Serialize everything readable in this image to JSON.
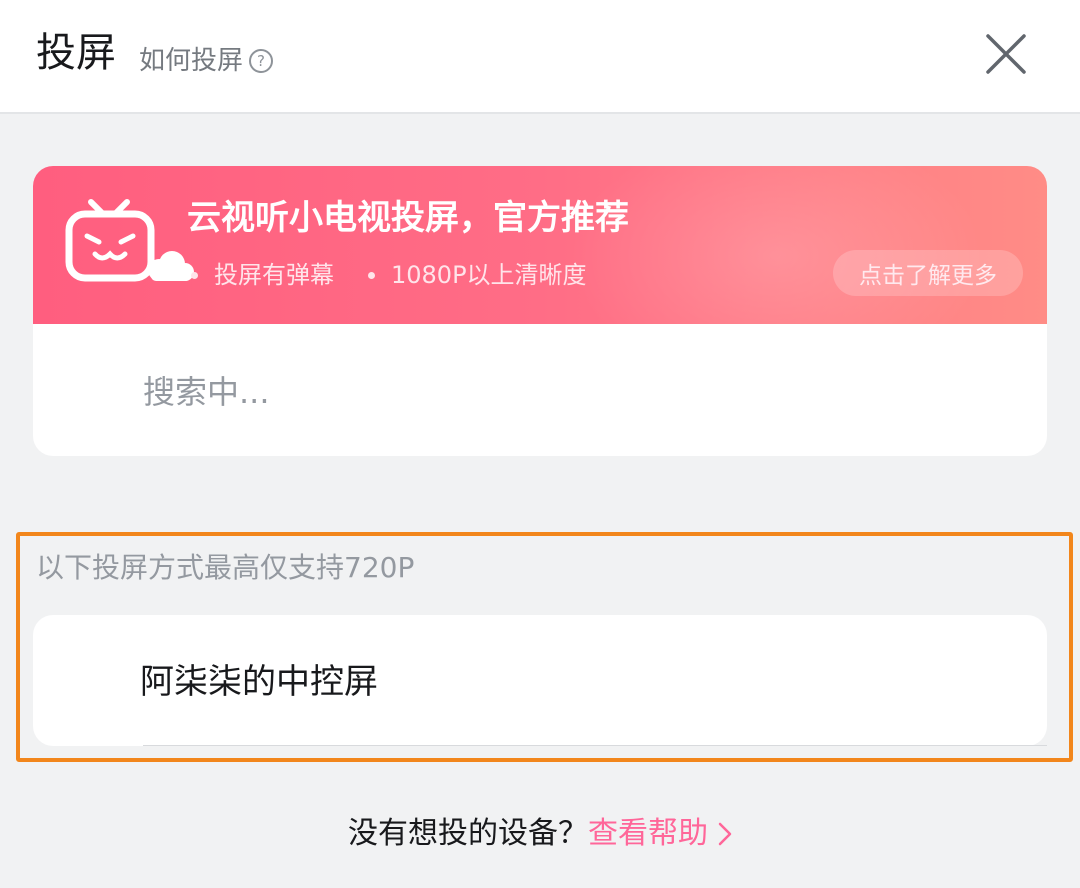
{
  "header": {
    "title": "投屏",
    "howto_label": "如何投屏",
    "help_icon_glyph": "?"
  },
  "promo": {
    "title": "云视听小电视投屏，官方推荐",
    "features": [
      "投屏有弹幕",
      "1080P以上清晰度"
    ],
    "learn_more": "点击了解更多"
  },
  "search_status": "搜索中...",
  "section": {
    "note": "以下投屏方式最高仅支持720P",
    "devices": [
      {
        "name": "阿柒柒的中控屏"
      }
    ]
  },
  "footer": {
    "question": "没有想投的设备？",
    "help_link": "查看帮助"
  },
  "colors": {
    "accent_pink": "#ff6699",
    "banner_start": "#ff5e7f",
    "banner_end": "#ff8c86",
    "highlight_orange": "#f2861b"
  },
  "icons": [
    "help-circle-icon",
    "close-icon",
    "tv-logo-icon",
    "cloud-icon",
    "chevron-right-icon"
  ]
}
